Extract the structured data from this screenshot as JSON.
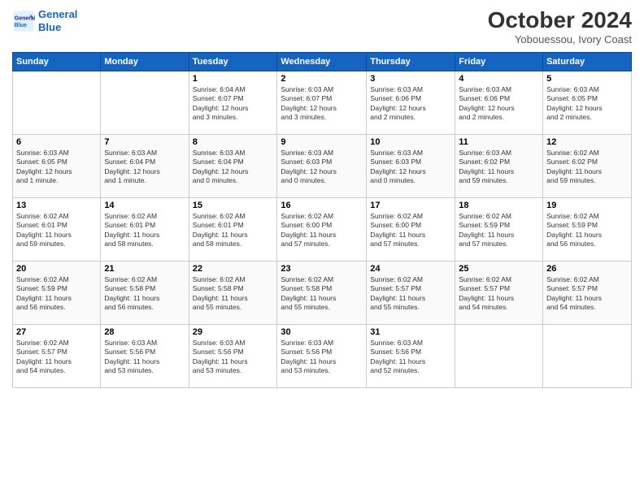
{
  "header": {
    "logo_line1": "General",
    "logo_line2": "Blue",
    "month_title": "October 2024",
    "subtitle": "Yobouessou, Ivory Coast"
  },
  "weekdays": [
    "Sunday",
    "Monday",
    "Tuesday",
    "Wednesday",
    "Thursday",
    "Friday",
    "Saturday"
  ],
  "weeks": [
    [
      {
        "day": "",
        "info": ""
      },
      {
        "day": "",
        "info": ""
      },
      {
        "day": "1",
        "info": "Sunrise: 6:04 AM\nSunset: 6:07 PM\nDaylight: 12 hours\nand 3 minutes."
      },
      {
        "day": "2",
        "info": "Sunrise: 6:03 AM\nSunset: 6:07 PM\nDaylight: 12 hours\nand 3 minutes."
      },
      {
        "day": "3",
        "info": "Sunrise: 6:03 AM\nSunset: 6:06 PM\nDaylight: 12 hours\nand 2 minutes."
      },
      {
        "day": "4",
        "info": "Sunrise: 6:03 AM\nSunset: 6:06 PM\nDaylight: 12 hours\nand 2 minutes."
      },
      {
        "day": "5",
        "info": "Sunrise: 6:03 AM\nSunset: 6:05 PM\nDaylight: 12 hours\nand 2 minutes."
      }
    ],
    [
      {
        "day": "6",
        "info": "Sunrise: 6:03 AM\nSunset: 6:05 PM\nDaylight: 12 hours\nand 1 minute."
      },
      {
        "day": "7",
        "info": "Sunrise: 6:03 AM\nSunset: 6:04 PM\nDaylight: 12 hours\nand 1 minute."
      },
      {
        "day": "8",
        "info": "Sunrise: 6:03 AM\nSunset: 6:04 PM\nDaylight: 12 hours\nand 0 minutes."
      },
      {
        "day": "9",
        "info": "Sunrise: 6:03 AM\nSunset: 6:03 PM\nDaylight: 12 hours\nand 0 minutes."
      },
      {
        "day": "10",
        "info": "Sunrise: 6:03 AM\nSunset: 6:03 PM\nDaylight: 12 hours\nand 0 minutes."
      },
      {
        "day": "11",
        "info": "Sunrise: 6:03 AM\nSunset: 6:02 PM\nDaylight: 11 hours\nand 59 minutes."
      },
      {
        "day": "12",
        "info": "Sunrise: 6:02 AM\nSunset: 6:02 PM\nDaylight: 11 hours\nand 59 minutes."
      }
    ],
    [
      {
        "day": "13",
        "info": "Sunrise: 6:02 AM\nSunset: 6:01 PM\nDaylight: 11 hours\nand 59 minutes."
      },
      {
        "day": "14",
        "info": "Sunrise: 6:02 AM\nSunset: 6:01 PM\nDaylight: 11 hours\nand 58 minutes."
      },
      {
        "day": "15",
        "info": "Sunrise: 6:02 AM\nSunset: 6:01 PM\nDaylight: 11 hours\nand 58 minutes."
      },
      {
        "day": "16",
        "info": "Sunrise: 6:02 AM\nSunset: 6:00 PM\nDaylight: 11 hours\nand 57 minutes."
      },
      {
        "day": "17",
        "info": "Sunrise: 6:02 AM\nSunset: 6:00 PM\nDaylight: 11 hours\nand 57 minutes."
      },
      {
        "day": "18",
        "info": "Sunrise: 6:02 AM\nSunset: 5:59 PM\nDaylight: 11 hours\nand 57 minutes."
      },
      {
        "day": "19",
        "info": "Sunrise: 6:02 AM\nSunset: 5:59 PM\nDaylight: 11 hours\nand 56 minutes."
      }
    ],
    [
      {
        "day": "20",
        "info": "Sunrise: 6:02 AM\nSunset: 5:59 PM\nDaylight: 11 hours\nand 56 minutes."
      },
      {
        "day": "21",
        "info": "Sunrise: 6:02 AM\nSunset: 5:58 PM\nDaylight: 11 hours\nand 56 minutes."
      },
      {
        "day": "22",
        "info": "Sunrise: 6:02 AM\nSunset: 5:58 PM\nDaylight: 11 hours\nand 55 minutes."
      },
      {
        "day": "23",
        "info": "Sunrise: 6:02 AM\nSunset: 5:58 PM\nDaylight: 11 hours\nand 55 minutes."
      },
      {
        "day": "24",
        "info": "Sunrise: 6:02 AM\nSunset: 5:57 PM\nDaylight: 11 hours\nand 55 minutes."
      },
      {
        "day": "25",
        "info": "Sunrise: 6:02 AM\nSunset: 5:57 PM\nDaylight: 11 hours\nand 54 minutes."
      },
      {
        "day": "26",
        "info": "Sunrise: 6:02 AM\nSunset: 5:57 PM\nDaylight: 11 hours\nand 54 minutes."
      }
    ],
    [
      {
        "day": "27",
        "info": "Sunrise: 6:02 AM\nSunset: 5:57 PM\nDaylight: 11 hours\nand 54 minutes."
      },
      {
        "day": "28",
        "info": "Sunrise: 6:03 AM\nSunset: 5:56 PM\nDaylight: 11 hours\nand 53 minutes."
      },
      {
        "day": "29",
        "info": "Sunrise: 6:03 AM\nSunset: 5:56 PM\nDaylight: 11 hours\nand 53 minutes."
      },
      {
        "day": "30",
        "info": "Sunrise: 6:03 AM\nSunset: 5:56 PM\nDaylight: 11 hours\nand 53 minutes."
      },
      {
        "day": "31",
        "info": "Sunrise: 6:03 AM\nSunset: 5:56 PM\nDaylight: 11 hours\nand 52 minutes."
      },
      {
        "day": "",
        "info": ""
      },
      {
        "day": "",
        "info": ""
      }
    ]
  ]
}
